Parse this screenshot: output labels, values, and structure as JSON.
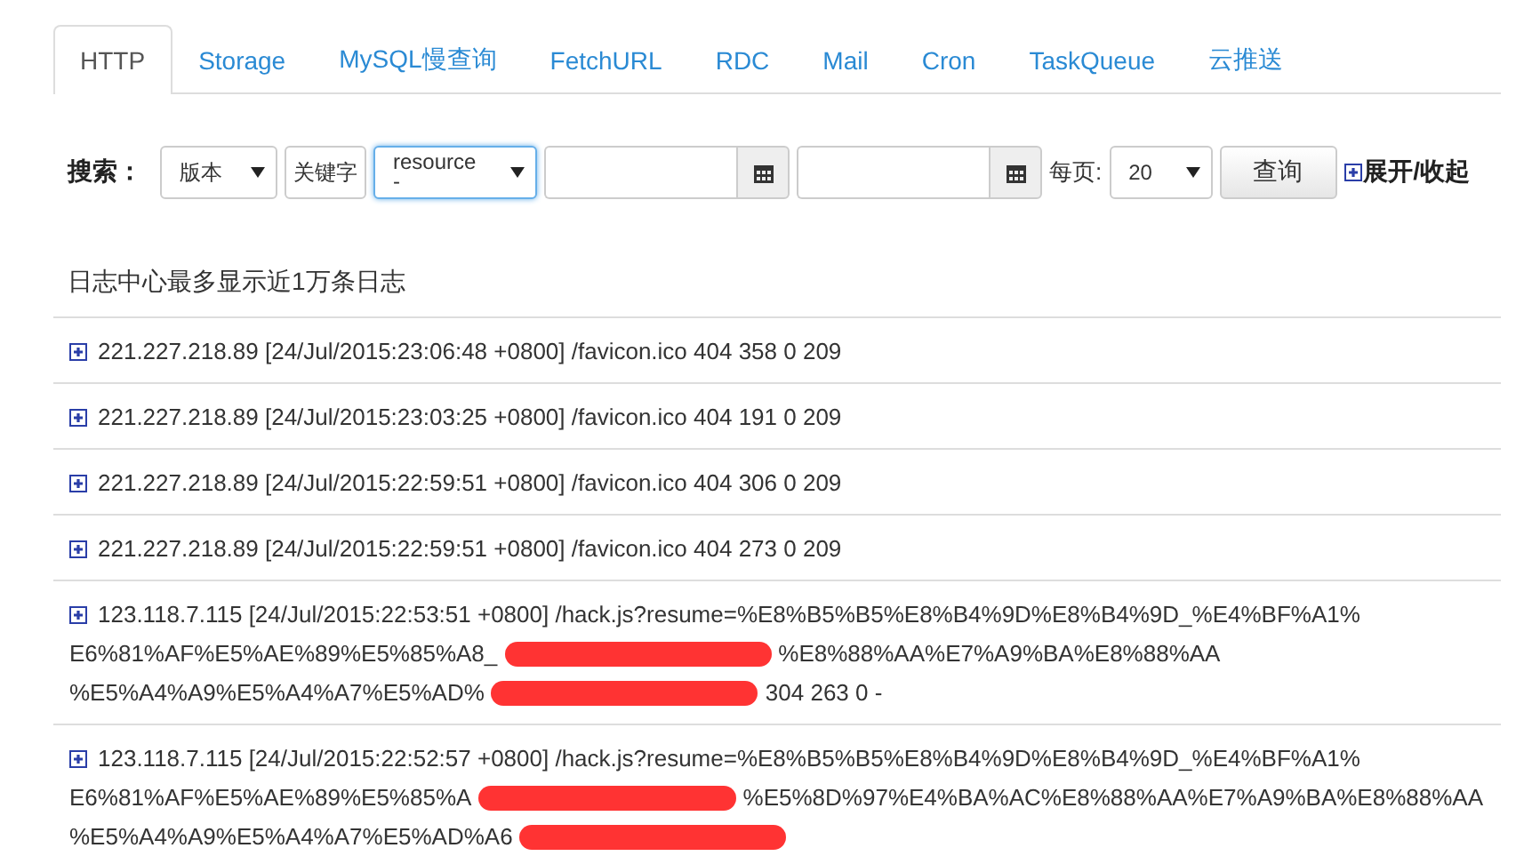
{
  "tabs": [
    {
      "label": "HTTP",
      "selected": true
    },
    {
      "label": "Storage",
      "selected": false
    },
    {
      "label": "MySQL慢查询",
      "selected": false
    },
    {
      "label": "FetchURL",
      "selected": false
    },
    {
      "label": "RDC",
      "selected": false
    },
    {
      "label": "Mail",
      "selected": false
    },
    {
      "label": "Cron",
      "selected": false
    },
    {
      "label": "TaskQueue",
      "selected": false
    },
    {
      "label": "云推送",
      "selected": false
    }
  ],
  "search": {
    "label": "搜索：",
    "version_select": "版本",
    "keyword_button": "关键字",
    "field_select": "resource\n-",
    "per_page_label": "每页:",
    "per_page_select": "20",
    "query_button": "查询",
    "toggle": "展开/收起"
  },
  "note": "日志中心最多显示近1万条日志",
  "rows": [
    {
      "lines": [
        [
          {
            "kind": "text",
            "text": "221.227.218.89 [24/Jul/2015:23:06:48 +0800] /favicon.ico 404 358 0 209"
          }
        ]
      ]
    },
    {
      "lines": [
        [
          {
            "kind": "text",
            "text": "221.227.218.89 [24/Jul/2015:23:03:25 +0800] /favicon.ico 404 191 0 209"
          }
        ]
      ]
    },
    {
      "lines": [
        [
          {
            "kind": "text",
            "text": "221.227.218.89 [24/Jul/2015:22:59:51 +0800] /favicon.ico 404 306 0 209"
          }
        ]
      ]
    },
    {
      "lines": [
        [
          {
            "kind": "text",
            "text": "221.227.218.89 [24/Jul/2015:22:59:51 +0800] /favicon.ico 404 273 0 209"
          }
        ]
      ]
    },
    {
      "lines": [
        [
          {
            "kind": "text",
            "text": "123.118.7.115 [24/Jul/2015:22:53:51 +0800] /hack.js?resume=%E8%B5%B5%E8%B4%9D%E8%B4%9D_%E4%BF%A1%"
          }
        ],
        [
          {
            "kind": "text",
            "text": "E6%81%AF%E5%AE%89%E5%85%A8_"
          },
          {
            "kind": "redaction"
          },
          {
            "kind": "text",
            "text": "%E8%88%AA%E7%A9%BA%E8%88%AA"
          }
        ],
        [
          {
            "kind": "text",
            "text": "%E5%A4%A9%E5%A4%A7%E5%AD%"
          },
          {
            "kind": "redaction"
          },
          {
            "kind": "text",
            "text": "304 263 0 -"
          }
        ]
      ]
    },
    {
      "lines": [
        [
          {
            "kind": "text",
            "text": "123.118.7.115 [24/Jul/2015:22:52:57 +0800] /hack.js?resume=%E8%B5%B5%E8%B4%9D%E8%B4%9D_%E4%BF%A1%"
          }
        ],
        [
          {
            "kind": "text",
            "text": "E6%81%AF%E5%AE%89%E5%85%A"
          },
          {
            "kind": "redaction"
          },
          {
            "kind": "text",
            "text": "%E5%8D%97%E4%BA%AC%E8%88%AA%E7%A9%BA%E8%88%AA"
          }
        ],
        [
          {
            "kind": "text",
            "text": "%E5%A4%A9%E5%A4%A7%E5%AD%A6"
          },
          {
            "kind": "redaction"
          }
        ]
      ]
    }
  ]
}
